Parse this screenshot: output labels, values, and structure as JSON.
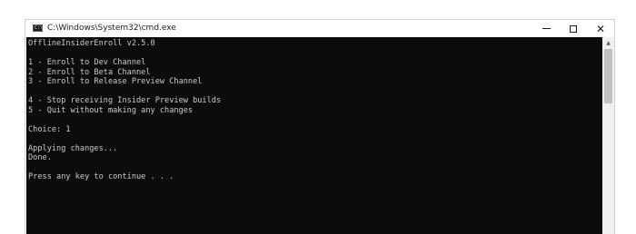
{
  "window": {
    "title": "C:\\Windows\\System32\\cmd.exe",
    "icon_text": "C:\\",
    "minimize_icon": "minimize-icon",
    "maximize_icon": "maximize-icon",
    "close_glyph": "✕"
  },
  "console": {
    "background_color": "#0c0c0c",
    "text_color": "#cccccc",
    "lines": [
      "OfflineInsiderEnroll v2.5.0",
      "",
      "1 - Enroll to Dev Channel",
      "2 - Enroll to Beta Channel",
      "3 - Enroll to Release Preview Channel",
      "",
      "4 - Stop receiving Insider Preview builds",
      "5 - Quit without making any changes",
      "",
      "Choice: 1",
      "",
      "Applying changes...",
      "Done.",
      "",
      "Press any key to continue . . ."
    ]
  },
  "scrollbar": {
    "up_arrow": "▲"
  }
}
